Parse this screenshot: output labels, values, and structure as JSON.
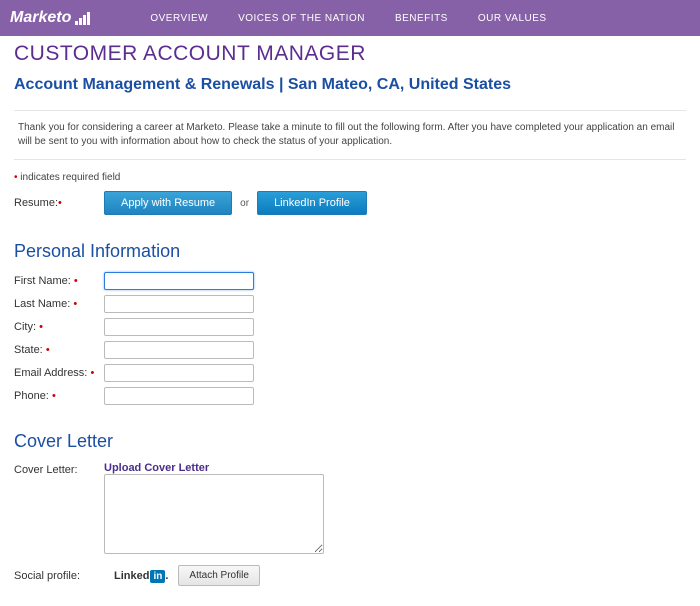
{
  "nav": {
    "brand": "Marketo",
    "links": [
      "OVERVIEW",
      "VOICES OF THE NATION",
      "BENEFITS",
      "OUR VALUES"
    ]
  },
  "title": "CUSTOMER ACCOUNT MANAGER",
  "subtitle": "Account Management & Renewals | San Mateo, CA, United States",
  "intro": "Thank you for considering a career at Marketo. Please take a minute to fill out the following form. After you have completed your application an email will be sent to you with information about how to check the status of your application.",
  "required_note": "indicates required field",
  "resume": {
    "label": "Resume:",
    "apply_btn": "Apply with Resume",
    "or": "or",
    "linkedin_btn": "LinkedIn Profile"
  },
  "personal": {
    "heading": "Personal Information",
    "fields": {
      "first_name": "First Name:",
      "last_name": "Last Name:",
      "city": "City:",
      "state": "State:",
      "email": "Email Address:",
      "phone": "Phone:"
    }
  },
  "cover": {
    "heading": "Cover Letter",
    "label": "Cover Letter:",
    "upload": "Upload Cover Letter"
  },
  "social": {
    "label": "Social profile:",
    "linkedin": "Linked",
    "in": "in",
    "attach": "Attach Profile"
  }
}
